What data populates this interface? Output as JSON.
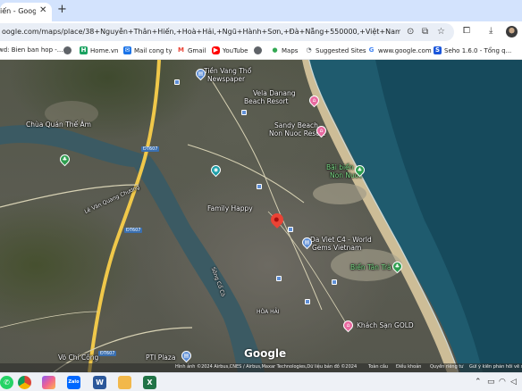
{
  "browser": {
    "tab": {
      "title": "iến - Googl",
      "close": "✕"
    },
    "new_tab": "+",
    "url": "oogle.com/maps/place/38+Nguyễn+Thân+Hiến,+Hoà+Hải,+Ngũ+Hành+Sơn,+Đà+Nẵng+550000,+Việt+Nam/@15.9929878...",
    "bookmarks": [
      {
        "label": "wd: Bien ban hop -...",
        "icon": "document-icon",
        "color": "#5f6368"
      },
      {
        "label": "",
        "icon": "globe-icon",
        "color": "#5f6368"
      },
      {
        "label": "Home.vn",
        "icon": "home-vn-icon",
        "color": "#1aa260"
      },
      {
        "label": "Mail cong ty",
        "icon": "mail-icon",
        "color": "#1a73e8"
      },
      {
        "label": "Gmail",
        "icon": "gmail-icon",
        "color": "#ea4335"
      },
      {
        "label": "YouTube",
        "icon": "youtube-icon",
        "color": "#ff0000"
      },
      {
        "label": "",
        "icon": "globe-icon",
        "color": "#5f6368"
      },
      {
        "label": "Maps",
        "icon": "maps-icon",
        "color": "#34a853"
      },
      {
        "label": "Suggested Sites",
        "icon": "suggested-sites-icon",
        "color": "#5f6368"
      },
      {
        "label": "www.google.com",
        "icon": "google-icon",
        "color": "#4285f4"
      },
      {
        "label": "Seho 1.6.0 - Tổng q...",
        "icon": "seho-icon",
        "color": "#1a56db"
      }
    ]
  },
  "map": {
    "labels": [
      {
        "text": "Tiền Vang Thổ",
        "style": "white"
      },
      {
        "text": "Newspaper",
        "style": "white"
      },
      {
        "text": "Vela Danang",
        "style": "white"
      },
      {
        "text": "Beach Resort",
        "style": "white"
      },
      {
        "text": "Sandy Beach",
        "style": "white"
      },
      {
        "text": "Non Nuoc Resort",
        "style": "white"
      },
      {
        "text": "Chùa Quán Thế Âm",
        "style": "white"
      },
      {
        "text": "Bãi biển",
        "style": "green"
      },
      {
        "text": "Non Nuoc",
        "style": "green"
      },
      {
        "text": "Lê Văn Quang Chương",
        "style": "white"
      },
      {
        "text": "Family Happy",
        "style": "white"
      },
      {
        "text": "Da Viet C4 - World",
        "style": "white"
      },
      {
        "text": "Gems Vietnam",
        "style": "white"
      },
      {
        "text": "Biển Tân Trà",
        "style": "green"
      },
      {
        "text": "Sông Cổ Cò",
        "style": "white"
      },
      {
        "text": "HÒA HẢI",
        "style": "white"
      },
      {
        "text": "Khách Sạn GOLD",
        "style": "white"
      },
      {
        "text": "Võ Chí Công",
        "style": "white"
      },
      {
        "text": "PTI Plaza",
        "style": "white"
      }
    ],
    "road_badges": [
      "ĐT607",
      "ĐT607",
      "ĐT607"
    ],
    "brand": "Google",
    "attribution": "Hình ảnh ©2024 Airbus,CNES / Airbus,Maxar Technologies,Dữ liệu bản đồ ©2024",
    "footer_links": [
      "Toàn cầu",
      "Điều khoản",
      "Quyền riêng tư",
      "Gửi ý kiến phản hồi về sản phẩm"
    ]
  },
  "taskbar": {
    "apps": [
      {
        "name": "whatsapp-icon",
        "glyph": "✆",
        "color": "#25d366"
      },
      {
        "name": "chrome-icon",
        "glyph": "●",
        "color": "#db4437"
      },
      {
        "name": "copilot-icon",
        "glyph": "◆",
        "color": "#8a5cf6"
      },
      {
        "name": "zalo-icon",
        "glyph": "Zalo",
        "color": "#0068ff"
      },
      {
        "name": "word-icon",
        "glyph": "W",
        "color": "#2b579a"
      },
      {
        "name": "file-explorer-icon",
        "glyph": "▬",
        "color": "#f2b84b"
      },
      {
        "name": "excel-icon",
        "glyph": "X",
        "color": "#217346"
      }
    ]
  }
}
